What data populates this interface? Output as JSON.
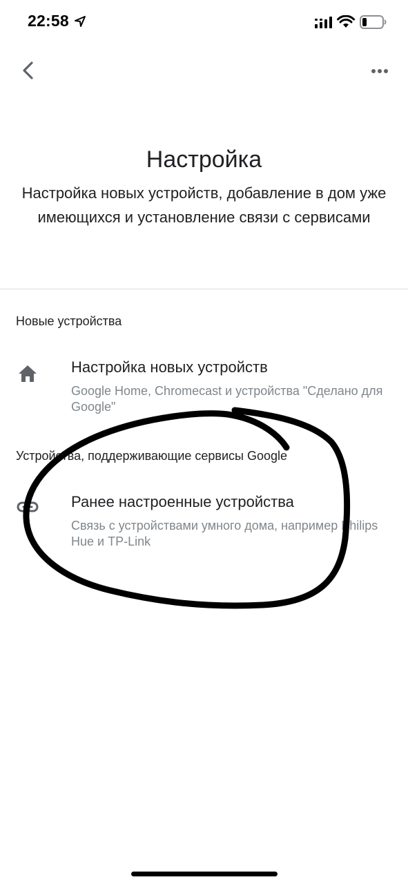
{
  "status_bar": {
    "time": "22:58",
    "icons": [
      "location-arrow-icon",
      "cellular-signal-icon",
      "wifi-icon",
      "battery-icon"
    ]
  },
  "toolbar": {
    "back_icon": "chevron-left-icon",
    "more_icon": "more-horizontal-icon"
  },
  "header": {
    "title": "Настройка",
    "subtitle": "Настройка новых устройств, добавление в дом уже имеющихся и установление связи с сервисами"
  },
  "sections": [
    {
      "header": "Новые устройства",
      "items": [
        {
          "icon": "home-icon",
          "title": "Настройка новых устройств",
          "description": "Google Home, Chromecast и устройства \"Сделано для Google\""
        }
      ]
    },
    {
      "header": "Устройства, поддерживающие сервисы Google",
      "items": [
        {
          "icon": "link-icon",
          "title": "Ранее настроенные устройства",
          "description": "Связь с устройствами умного дома, например Philips Hue и TP-Link"
        }
      ]
    }
  ],
  "colors": {
    "text_primary": "#202124",
    "text_secondary": "#80868b",
    "icon": "#5f6368",
    "divider": "#dadce0",
    "annotation_stroke": "#000000"
  }
}
